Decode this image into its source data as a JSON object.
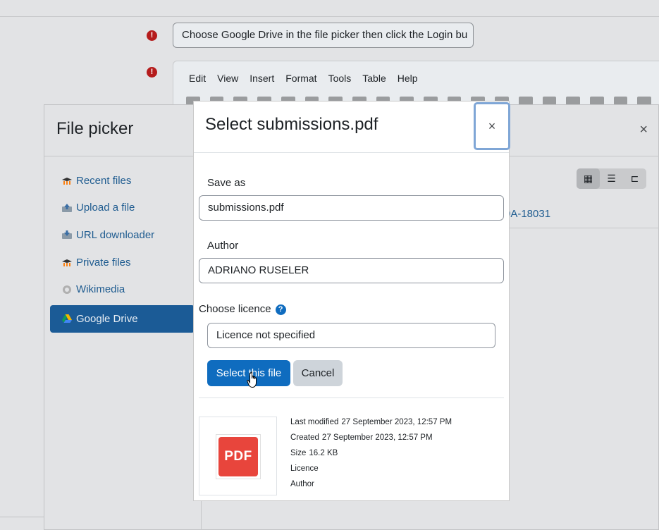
{
  "background": {
    "instruction_text": "Choose Google Drive in the file picker then click the Login bu",
    "editor_menu": [
      "Edit",
      "View",
      "Insert",
      "Format",
      "Tools",
      "Table",
      "Help"
    ]
  },
  "file_picker": {
    "title": "File picker",
    "close_symbol": "×",
    "nav_items": [
      {
        "label": "Recent files",
        "icon": "moodle-hat-icon"
      },
      {
        "label": "Upload a file",
        "icon": "upload-icon"
      },
      {
        "label": "URL downloader",
        "icon": "url-download-icon"
      },
      {
        "label": "Private files",
        "icon": "moodle-hat-icon"
      },
      {
        "label": "Wikimedia",
        "icon": "wikimedia-icon"
      },
      {
        "label": "Google Drive",
        "icon": "google-drive-icon",
        "active": true
      }
    ],
    "path_fragment": "0A-18031"
  },
  "modal": {
    "title": "Select submissions.pdf",
    "close_symbol": "×",
    "save_as_label": "Save as",
    "save_as_value": "submissions.pdf",
    "author_label": "Author",
    "author_value": "ADRIANO RUSELER",
    "licence_label": "Choose licence",
    "licence_value": "Licence not specified",
    "select_button": "Select this file",
    "cancel_button": "Cancel",
    "thumbnail_label": "PDF",
    "meta": [
      {
        "label": "Last modified",
        "value": "27 September 2023, 12:57 PM"
      },
      {
        "label": "Created",
        "value": "27 September 2023, 12:57 PM"
      },
      {
        "label": "Size",
        "value": "16.2 KB"
      },
      {
        "label": "Licence",
        "value": ""
      },
      {
        "label": "Author",
        "value": ""
      }
    ]
  },
  "colors": {
    "primary": "#0f6cbf",
    "active_nav": "#1b5b96",
    "link": "#1f5c90",
    "required": "#b51c1c",
    "pdf_red": "#e8453c"
  }
}
